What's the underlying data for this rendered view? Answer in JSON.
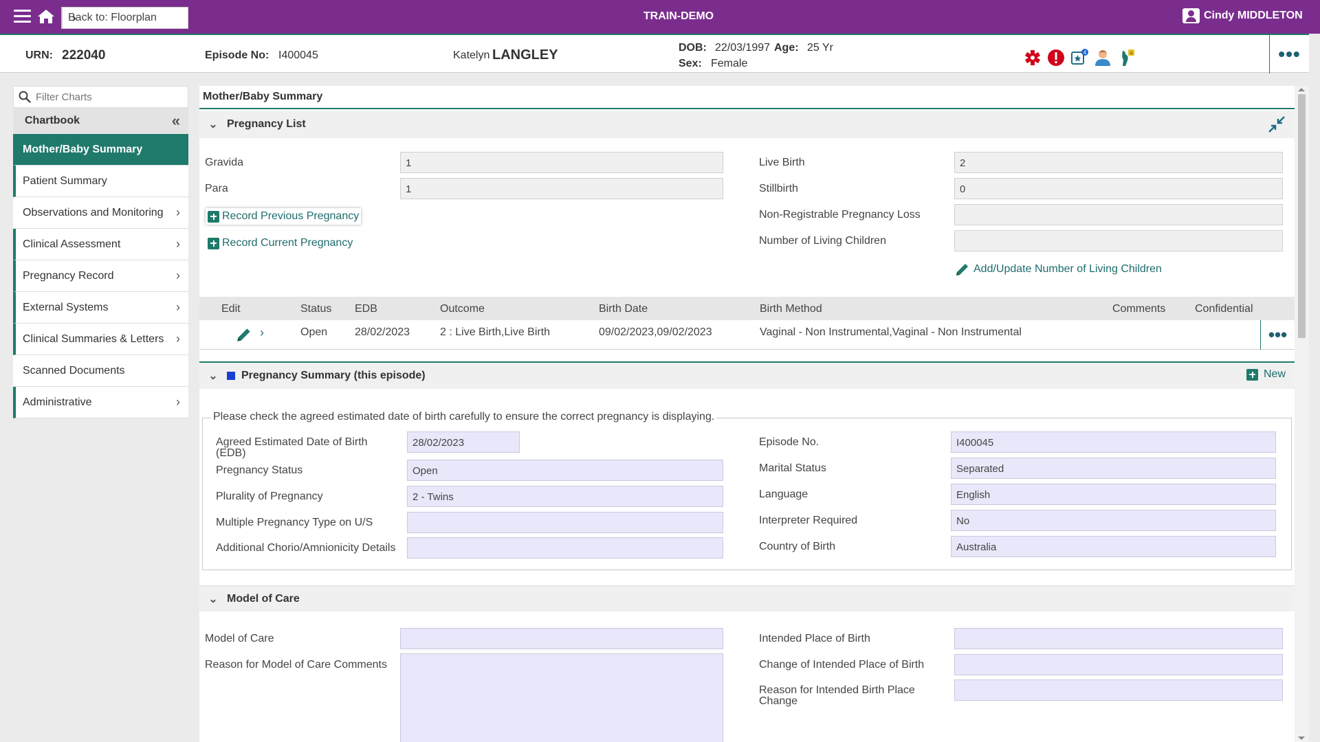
{
  "topbar": {
    "back_label": "Back to: Floorplan",
    "env": "TRAIN-DEMO",
    "user": "Cindy MIDDLETON"
  },
  "banner": {
    "urn_label": "URN:",
    "urn": "222040",
    "episode_label": "Episode No:",
    "episode": "I400045",
    "first_name": "Katelyn",
    "last_name": "LANGLEY",
    "dob_label": "DOB:",
    "dob": "22/03/1997",
    "age_label": "Age:",
    "age": "25 Yr",
    "sex_label": "Sex:",
    "sex": "Female",
    "more": "•••",
    "icons": [
      "medical-alert-icon",
      "alert-exclamation-icon",
      "task-star-icon",
      "clinician-icon",
      "pregnancy-icon"
    ],
    "task_badge": "4"
  },
  "sidebar": {
    "filter_placeholder": "Filter Charts",
    "chartbook_label": "Chartbook",
    "items": [
      {
        "label": "Mother/Baby Summary",
        "active": true
      },
      {
        "label": "Patient Summary"
      },
      {
        "label": "Observations and Monitoring"
      },
      {
        "label": "Clinical Assessment"
      },
      {
        "label": "Pregnancy Record"
      },
      {
        "label": "External Systems"
      },
      {
        "label": "Clinical Summaries & Letters"
      },
      {
        "label": "Scanned Documents"
      },
      {
        "label": "Administrative"
      }
    ]
  },
  "main": {
    "title": "Mother/Baby Summary",
    "pregnancy_list": {
      "header": "Pregnancy List",
      "gravida_label": "Gravida",
      "gravida": "1",
      "para_label": "Para",
      "para": "1",
      "live_birth_label": "Live Birth",
      "live_birth": "2",
      "stillbirth_label": "Stillbirth",
      "stillbirth": "0",
      "nrpl_label": "Non-Registrable Pregnancy Loss",
      "nrpl": "",
      "living_children_label": "Number of Living Children",
      "living_children": "",
      "record_prev": "Record Previous Pregnancy",
      "record_curr": "Record Current Pregnancy",
      "add_update": "Add/Update Number of Living Children"
    },
    "table": {
      "headers": [
        "Edit",
        "Status",
        "EDB",
        "Outcome",
        "Birth Date",
        "Birth Method",
        "Comments",
        "Confidential"
      ],
      "row": {
        "status": "Open",
        "edb": "28/02/2023",
        "outcome": "2 :  Live Birth,Live Birth",
        "birth_date": "09/02/2023,09/02/2023",
        "birth_method": "Vaginal - Non Instrumental,Vaginal - Non Instrumental"
      },
      "row_more": "•••"
    },
    "pregnancy_summary": {
      "header": "Pregnancy Summary (this episode)",
      "new_label": "New",
      "notice": "Please check the agreed estimated date of birth carefully to ensure the correct pregnancy is displaying.",
      "edb_label": "Agreed Estimated Date of Birth (EDB)",
      "edb": "28/02/2023",
      "status_label": "Pregnancy Status",
      "status": "Open",
      "plurality_label": "Plurality of Pregnancy",
      "plurality": "2 - Twins",
      "multi_type_label": "Multiple Pregnancy Type on U/S",
      "multi_type": "",
      "chorio_label": "Additional Chorio/Amnionicity Details",
      "chorio": "",
      "episode_label": "Episode No.",
      "episode": "I400045",
      "marital_label": "Marital Status",
      "marital": "Separated",
      "language_label": "Language",
      "language": "English",
      "interpreter_label": "Interpreter Required",
      "interpreter": "No",
      "country_label": "Country of Birth",
      "country": "Australia"
    },
    "model_of_care": {
      "header": "Model of Care",
      "moc_label": "Model of Care",
      "moc": "",
      "reason_label": "Reason for Model of Care Comments",
      "reason": "",
      "intended_label": "Intended Place of Birth",
      "intended": "",
      "change_label": "Change of Intended Place of Birth",
      "change": "",
      "reason_change_label": "Reason for Intended Birth Place Change",
      "reason_change": ""
    }
  },
  "colors": {
    "brand": "#7b2d8e",
    "accent": "#1f7a6b",
    "field_blue": "#e8e8fa"
  }
}
